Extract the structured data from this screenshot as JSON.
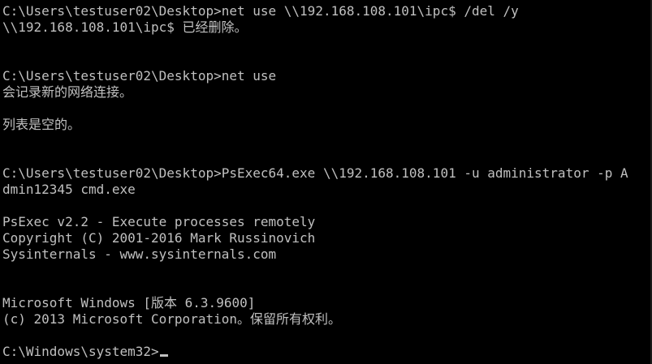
{
  "console": {
    "lines": [
      "C:\\Users\\testuser02\\Desktop>net use \\\\192.168.108.101\\ipc$ /del /y",
      "\\\\192.168.108.101\\ipc$ 已经删除。",
      "",
      "",
      "C:\\Users\\testuser02\\Desktop>net use",
      "会记录新的网络连接。",
      "",
      "列表是空的。",
      "",
      "",
      "C:\\Users\\testuser02\\Desktop>PsExec64.exe \\\\192.168.108.101 -u administrator -p A",
      "dmin12345 cmd.exe",
      "",
      "PsExec v2.2 - Execute processes remotely",
      "Copyright (C) 2001-2016 Mark Russinovich",
      "Sysinternals - www.sysinternals.com",
      "",
      "",
      "Microsoft Windows [版本 6.3.9600]",
      "(c) 2013 Microsoft Corporation。保留所有权利。",
      "",
      "C:\\Windows\\system32>"
    ]
  }
}
